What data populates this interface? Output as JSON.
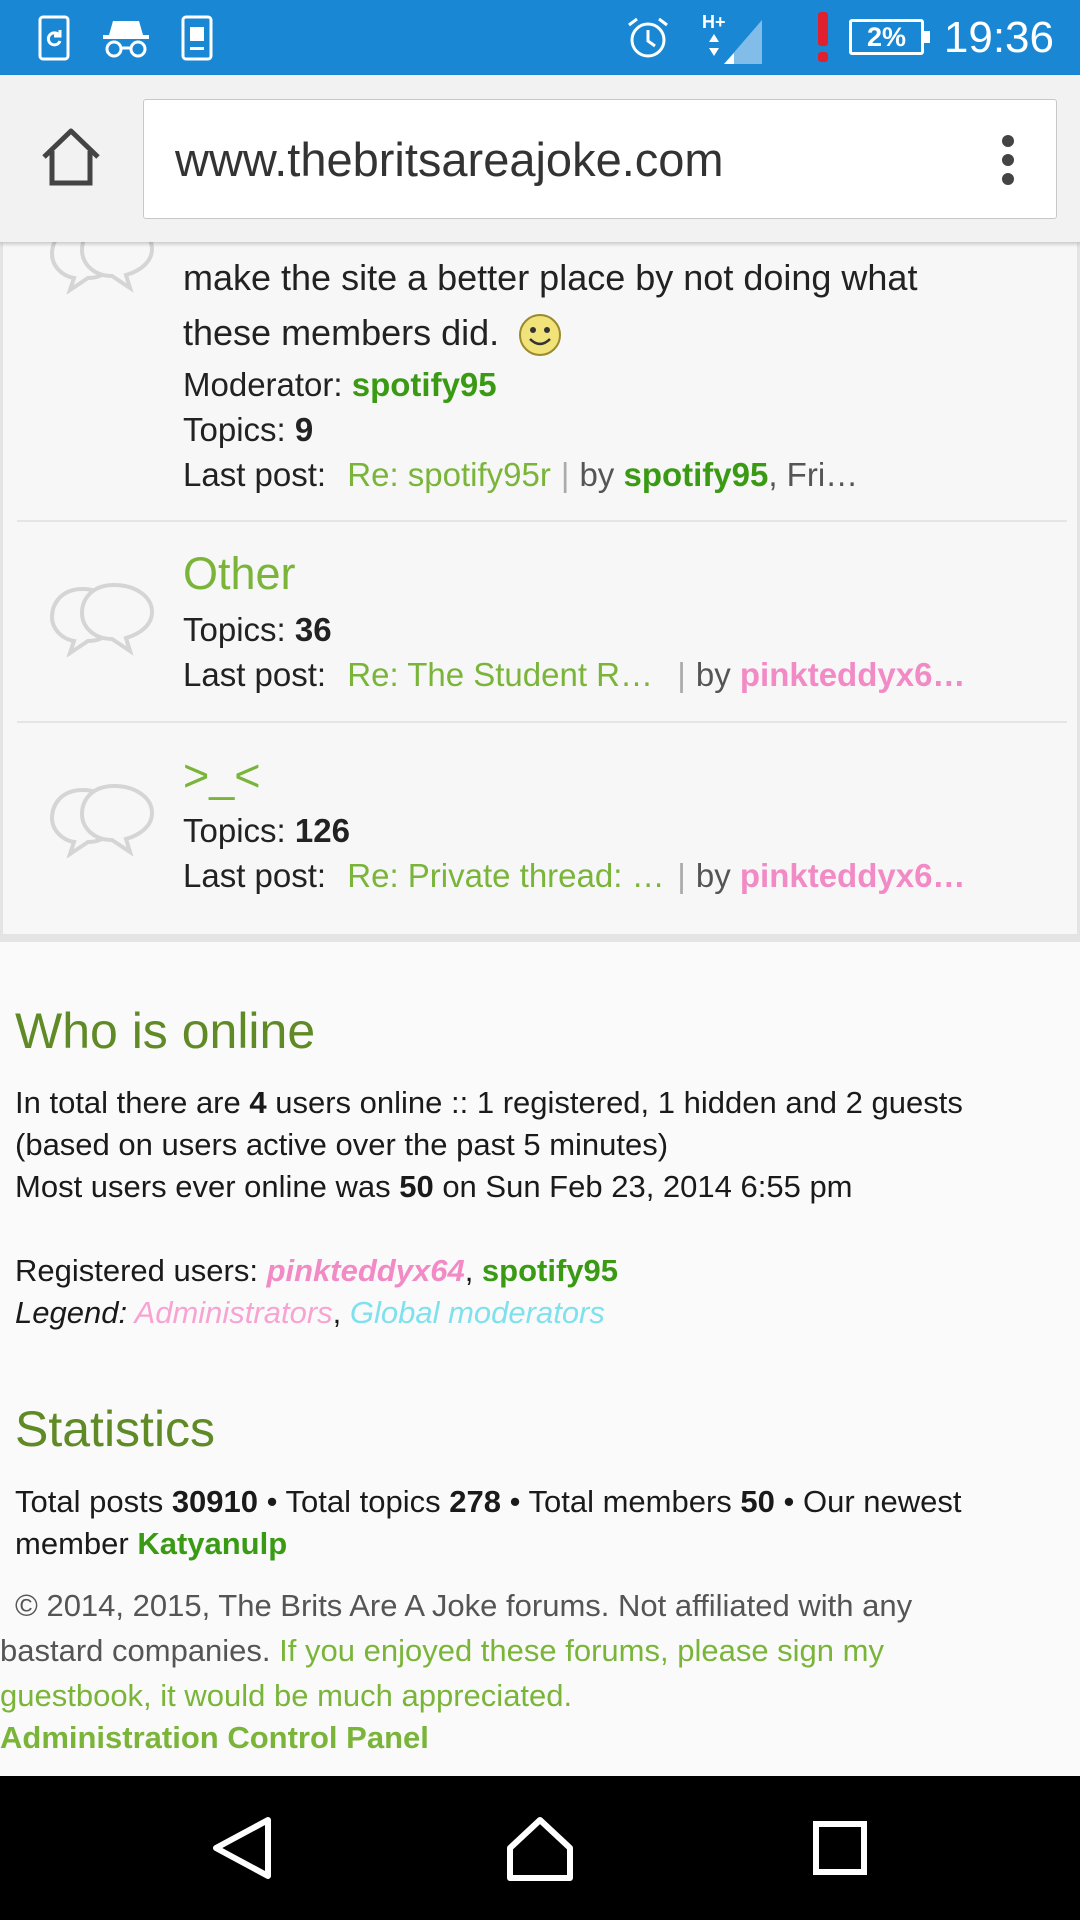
{
  "status_bar": {
    "time": "19:36",
    "battery": "2%",
    "network": "H+",
    "colors": {
      "background": "#1a87d5",
      "alert": "#e0202e"
    },
    "icons": [
      "sync-app-icon",
      "incognito-icon",
      "sim-toolkit-icon",
      "alarm-icon",
      "signal-icon",
      "alert-icon",
      "battery-icon"
    ]
  },
  "browser": {
    "url": "www.thebritsareajoke.com"
  },
  "forums": {
    "top_partial": {
      "description_line1": "make the site a better place by not doing what",
      "description_line2": "these members did.",
      "moderator_label": "Moderator:",
      "moderator": "spotify95",
      "topics_label": "Topics:",
      "topics": "9",
      "last_post_label": "Last post:",
      "last_post_title": "Re: spotify95r",
      "by_label": "by",
      "last_post_author": "spotify95",
      "last_post_suffix": ", Fri…"
    },
    "other": {
      "title": "Other",
      "topics_label": "Topics:",
      "topics": "36",
      "last_post_label": "Last post:",
      "last_post_title": "Re: The Student R…",
      "by_label": "by",
      "last_post_author": "pinkteddyx6…"
    },
    "face": {
      "title": ">_<",
      "topics_label": "Topics:",
      "topics": "126",
      "last_post_label": "Last post:",
      "last_post_title": "Re: Private thread: …",
      "by_label": "by",
      "last_post_author": "pinkteddyx6…"
    }
  },
  "who_is_online": {
    "title": "Who is online",
    "line1_pre": "In total there are ",
    "line1_count": "4",
    "line1_post": " users online :: 1 registered, 1 hidden and 2 guests",
    "line2": "(based on users active over the past 5 minutes)",
    "line3_pre": "Most users ever online was ",
    "line3_count": "50",
    "line3_post": " on Sun Feb 23, 2014 6:55 pm",
    "registered_label": "Registered users: ",
    "registered_user1": "pinkteddyx64",
    "registered_sep": ", ",
    "registered_user2": "spotify95",
    "legend_label": "Legend: ",
    "legend_admins": "Administrators",
    "legend_sep": ", ",
    "legend_mods": "Global moderators"
  },
  "statistics": {
    "title": "Statistics",
    "posts_label": "Total posts ",
    "posts": "30910",
    "topics_label": " • Total topics ",
    "topics": "278",
    "members_label": " • Total members ",
    "members": "50",
    "newest_label": " • Our newest",
    "member_word": "member ",
    "newest_member": "Katyanulp"
  },
  "footer": {
    "copyright_line1": "© 2014, 2015, The Brits Are A Joke forums. Not affiliated with any",
    "copyright_line2_gray": "bastard companies. ",
    "copyright_line2_green": "If you enjoyed these forums, please sign my",
    "copyright_line3_green": "guestbook, it would be much appreciated.",
    "acp_link": "Administration Control Panel"
  },
  "nav_bar": {
    "icons": [
      "back-icon",
      "home-icon",
      "recents-icon"
    ]
  }
}
